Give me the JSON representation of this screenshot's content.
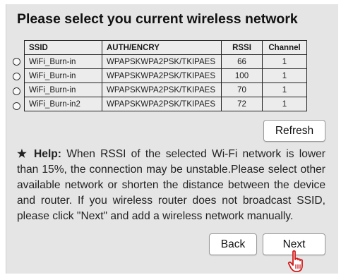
{
  "page": {
    "title": "Please select you current wireless network"
  },
  "table": {
    "headers": {
      "ssid": "SSID",
      "auth": "AUTH/ENCRY",
      "rssi": "RSSI",
      "channel": "Channel"
    },
    "rows": [
      {
        "ssid": "WiFi_Burn-in",
        "auth": "WPAPSKWPA2PSK/TKIPAES",
        "rssi": "66",
        "channel": "1"
      },
      {
        "ssid": "WiFi_Burn-in",
        "auth": "WPAPSKWPA2PSK/TKIPAES",
        "rssi": "100",
        "channel": "1"
      },
      {
        "ssid": "WiFi_Burn-in",
        "auth": "WPAPSKWPA2PSK/TKIPAES",
        "rssi": "70",
        "channel": "1"
      },
      {
        "ssid": "WiFi_Burn-in2",
        "auth": "WPAPSKWPA2PSK/TKIPAES",
        "rssi": "72",
        "channel": "1"
      }
    ]
  },
  "buttons": {
    "refresh": "Refresh",
    "back": "Back",
    "next": "Next"
  },
  "help": {
    "star": "★",
    "label": "Help:",
    "text": "When RSSI of the selected Wi-Fi network is lower than 15%, the connection may be unstable.Please select other available network or shorten the distance between the device and router. If you wireless router does not broadcast SSID, please click \"Next\" and add a wireless network manually."
  },
  "icons": {
    "cursor": "hand-pointer-icon",
    "radio": "radio-button-icon"
  }
}
